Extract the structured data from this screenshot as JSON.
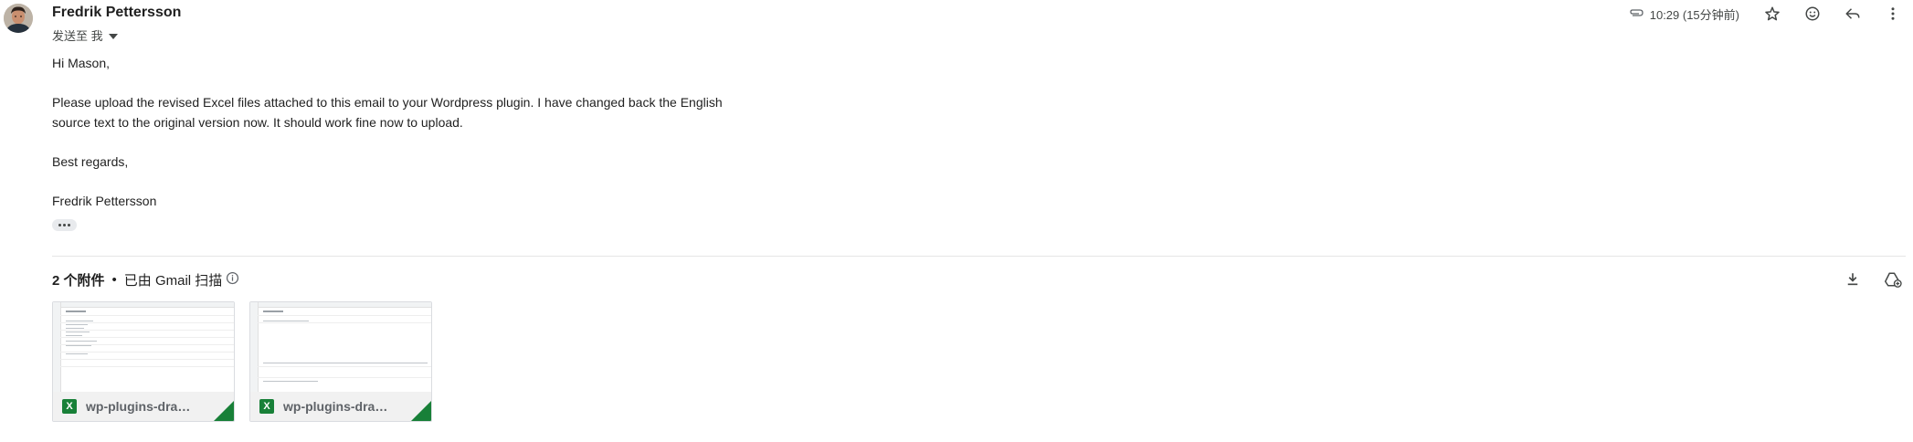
{
  "message": {
    "sender_name": "Fredrik Pettersson",
    "recipient_label": "发送至 我",
    "time": "10:29 (15分钟前)",
    "body_lines": [
      "Hi Mason,",
      "Please upload the revised Excel files attached to this email to your Wordpress plugin. I have changed back the English",
      "source text to the original version now. It should work fine now to upload.",
      "Best regards,",
      "Fredrik Pettersson"
    ]
  },
  "attachments": {
    "count_label": "2 个附件",
    "separator": "•",
    "scan_label": "已由 Gmail 扫描",
    "items": [
      {
        "name": "wp-plugins-drapl...",
        "type_letter": "X"
      },
      {
        "name": "wp-plugins-drapl...",
        "type_letter": "X"
      }
    ]
  },
  "icons": {
    "attachment": "paperclip-icon",
    "star": "star-icon",
    "emoji": "emoji-icon",
    "reply": "reply-icon",
    "more": "more-vert-icon",
    "download": "download-icon",
    "drive": "add-to-drive-icon",
    "info": "info-icon",
    "dropdown": "dropdown-icon"
  },
  "colors": {
    "excel_green": "#188038",
    "text_primary": "#1f1f1f",
    "text_secondary": "#444746"
  }
}
